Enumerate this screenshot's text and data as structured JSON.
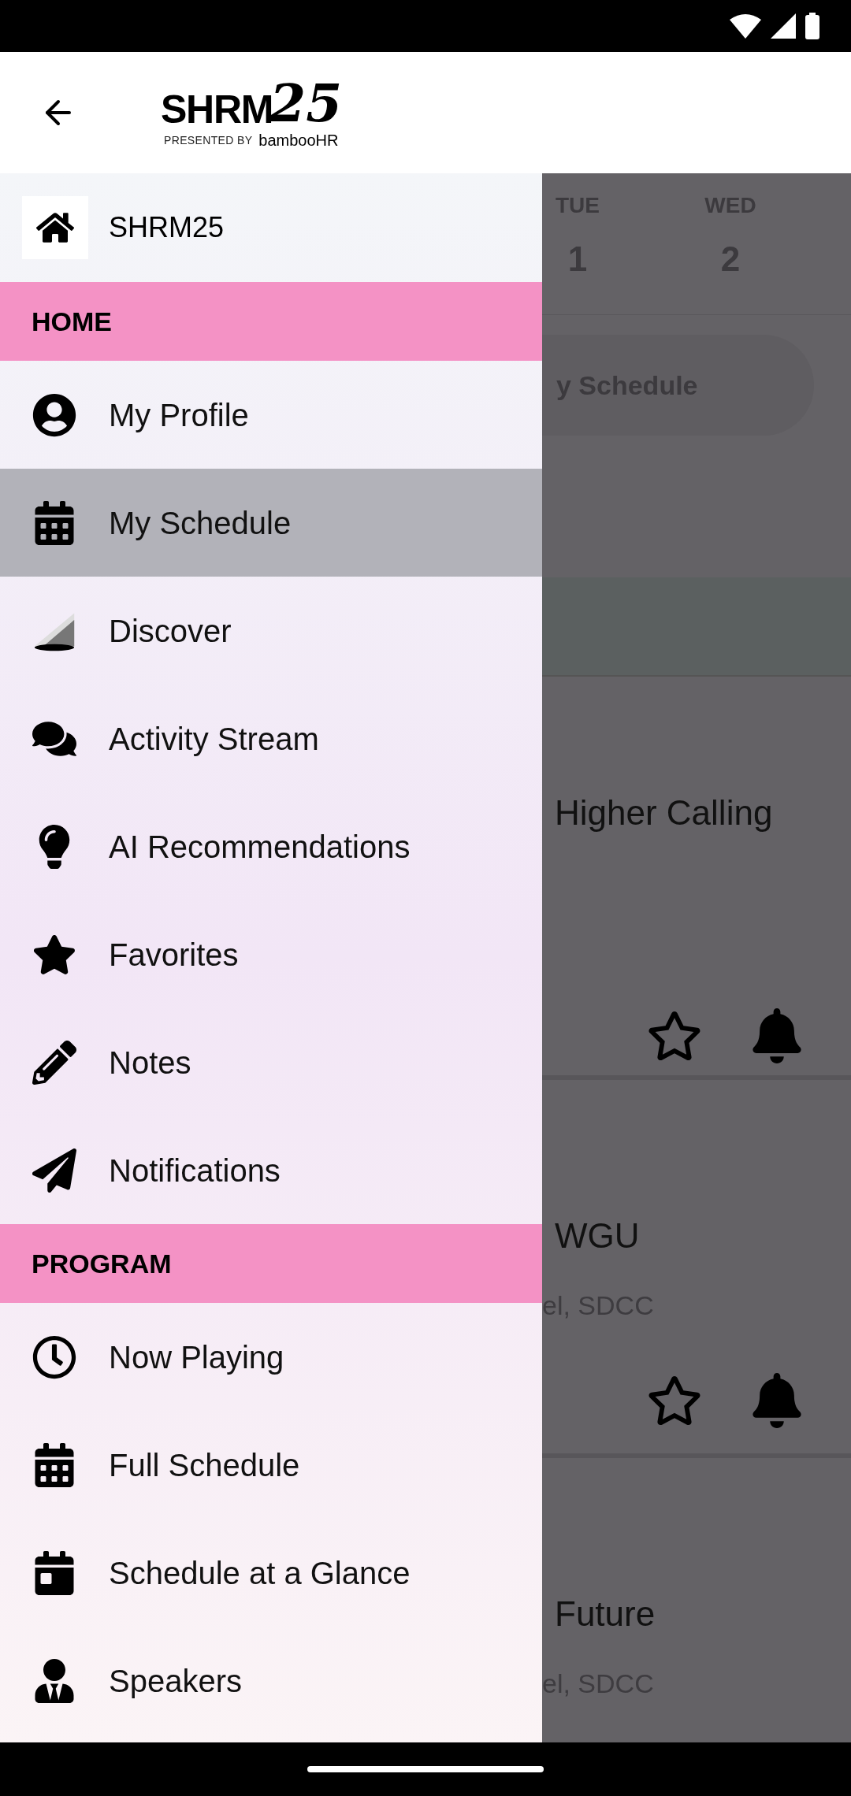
{
  "header": {
    "logo_main": "SHRM",
    "logo_number": "25",
    "logo_presented": "PRESENTED BY",
    "logo_sponsor": "bambooHR"
  },
  "background": {
    "days": [
      {
        "day": "TUE",
        "date": "1"
      },
      {
        "day": "WED",
        "date": "2"
      }
    ],
    "schedule_button": "y Schedule",
    "sessions": [
      {
        "title": "Higher Calling"
      },
      {
        "title": "WGU",
        "location": "el, SDCC"
      },
      {
        "title": "Future",
        "location": "el, SDCC"
      }
    ]
  },
  "drawer": {
    "home": "SHRM25",
    "sections": [
      {
        "title": "HOME",
        "items": [
          {
            "label": "My Profile",
            "selected": false
          },
          {
            "label": "My Schedule",
            "selected": true
          },
          {
            "label": "Discover",
            "selected": false
          },
          {
            "label": "Activity Stream",
            "selected": false
          },
          {
            "label": "AI Recommendations",
            "selected": false
          },
          {
            "label": "Favorites",
            "selected": false
          },
          {
            "label": "Notes",
            "selected": false
          },
          {
            "label": "Notifications",
            "selected": false
          }
        ]
      },
      {
        "title": "PROGRAM",
        "items": [
          {
            "label": "Now Playing",
            "selected": false
          },
          {
            "label": "Full Schedule",
            "selected": false
          },
          {
            "label": "Schedule at a Glance",
            "selected": false
          },
          {
            "label": "Speakers",
            "selected": false
          }
        ]
      }
    ]
  }
}
